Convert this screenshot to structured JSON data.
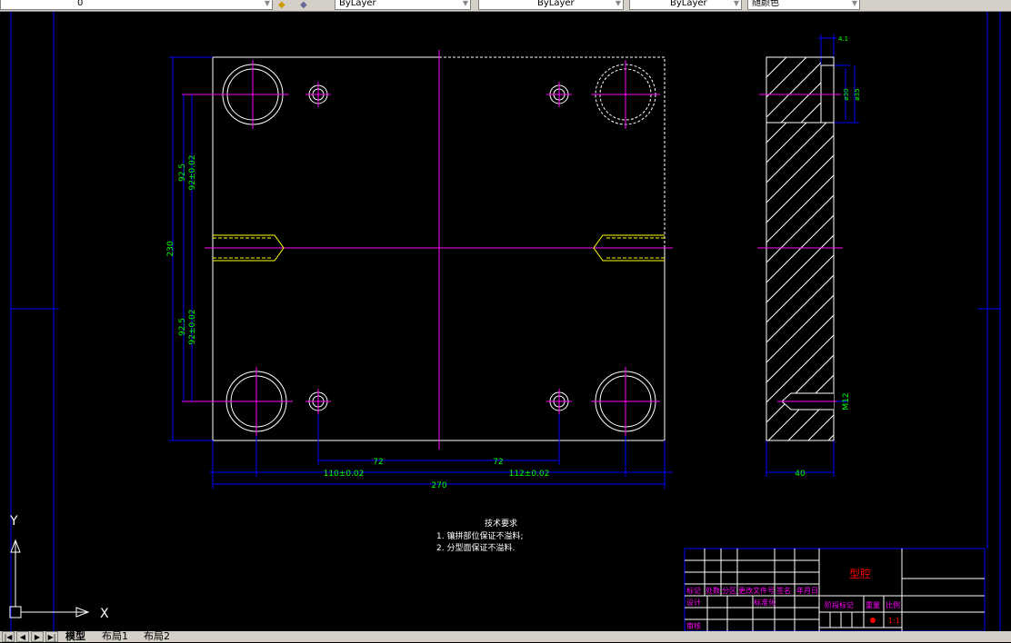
{
  "toolbar": {
    "layer_value": "0",
    "color_value": "ByLayer",
    "linetype_value": "ByLayer",
    "lineweight_value": "ByLayer",
    "plotstyle_value": "随颜色"
  },
  "drawing": {
    "dims": {
      "height_total": "230",
      "half_upper": "92.5",
      "half_upper_tol": "92±0.02",
      "half_lower": "92.5",
      "half_lower_tol": "92±0.02",
      "hole_left": "72",
      "hole_right": "72",
      "boss_left": "110±0.02",
      "boss_right": "112±0.02",
      "width_total": "270",
      "side_width": "40",
      "side_thread": "M12",
      "side_depth": "4.1",
      "side_bore_inner": "ø30",
      "side_bore_outer": "ø35"
    },
    "notes": {
      "title": "技术要求",
      "line1": "1. 镶拼部位保证不溢料;",
      "line2": "2. 分型面保证不溢料."
    },
    "title_block": {
      "part_name": "型腔",
      "mark": "标记",
      "count": "处数",
      "zone": "分区",
      "change_doc": "更改文件号",
      "sign": "签名",
      "date": "年月日",
      "design": "设计",
      "standard": "标准化",
      "review": "审核",
      "stage": "阶段标记",
      "weight": "重量",
      "scale": "比例",
      "scale_value": "1:1"
    },
    "ucs": {
      "x": "X",
      "y": "Y"
    },
    "colors": {
      "outline": "#ffffff",
      "center": "#ff00ff",
      "dim": "#0000ff",
      "dimtext": "#00ff00",
      "thread": "#ffff00",
      "title_text": "#ff00ff",
      "part_name": "#ff0000"
    }
  },
  "tabs": {
    "model": "模型",
    "layout1": "布局1",
    "layout2": "布局2"
  }
}
